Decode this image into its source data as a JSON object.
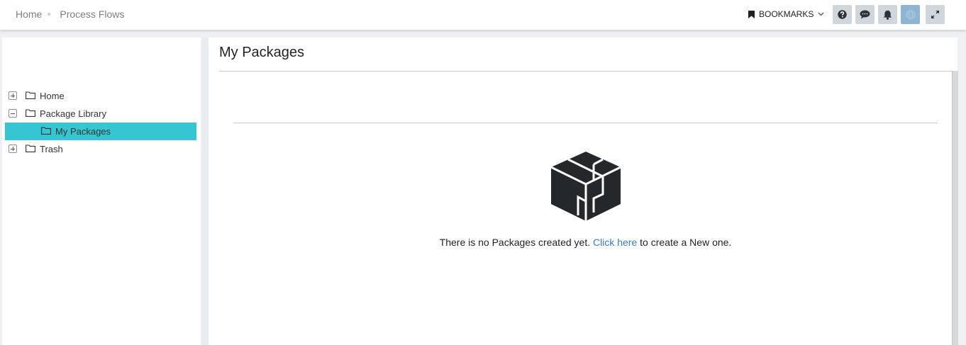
{
  "breadcrumb": {
    "home": "Home",
    "process_flows": "Process Flows"
  },
  "toolbar": {
    "bookmarks_label": "BOOKMARKS",
    "buttons": [
      "help-icon",
      "chat-icon",
      "bell-icon",
      "globe-icon",
      "expand-icon"
    ]
  },
  "tree": {
    "items": [
      {
        "label": "Home",
        "state": "collapsed"
      },
      {
        "label": "Package Library",
        "state": "expanded"
      },
      {
        "label": "My Packages",
        "selected": true
      },
      {
        "label": "Trash",
        "state": "collapsed"
      }
    ]
  },
  "main": {
    "title": "My Packages",
    "empty_before": "There is no Packages created yet. ",
    "empty_link": "Click here",
    "empty_after": " to create a New one."
  },
  "colors": {
    "accent": "#36c6d3",
    "link": "#3a7cc2",
    "active_button": "#8fb4d3"
  }
}
